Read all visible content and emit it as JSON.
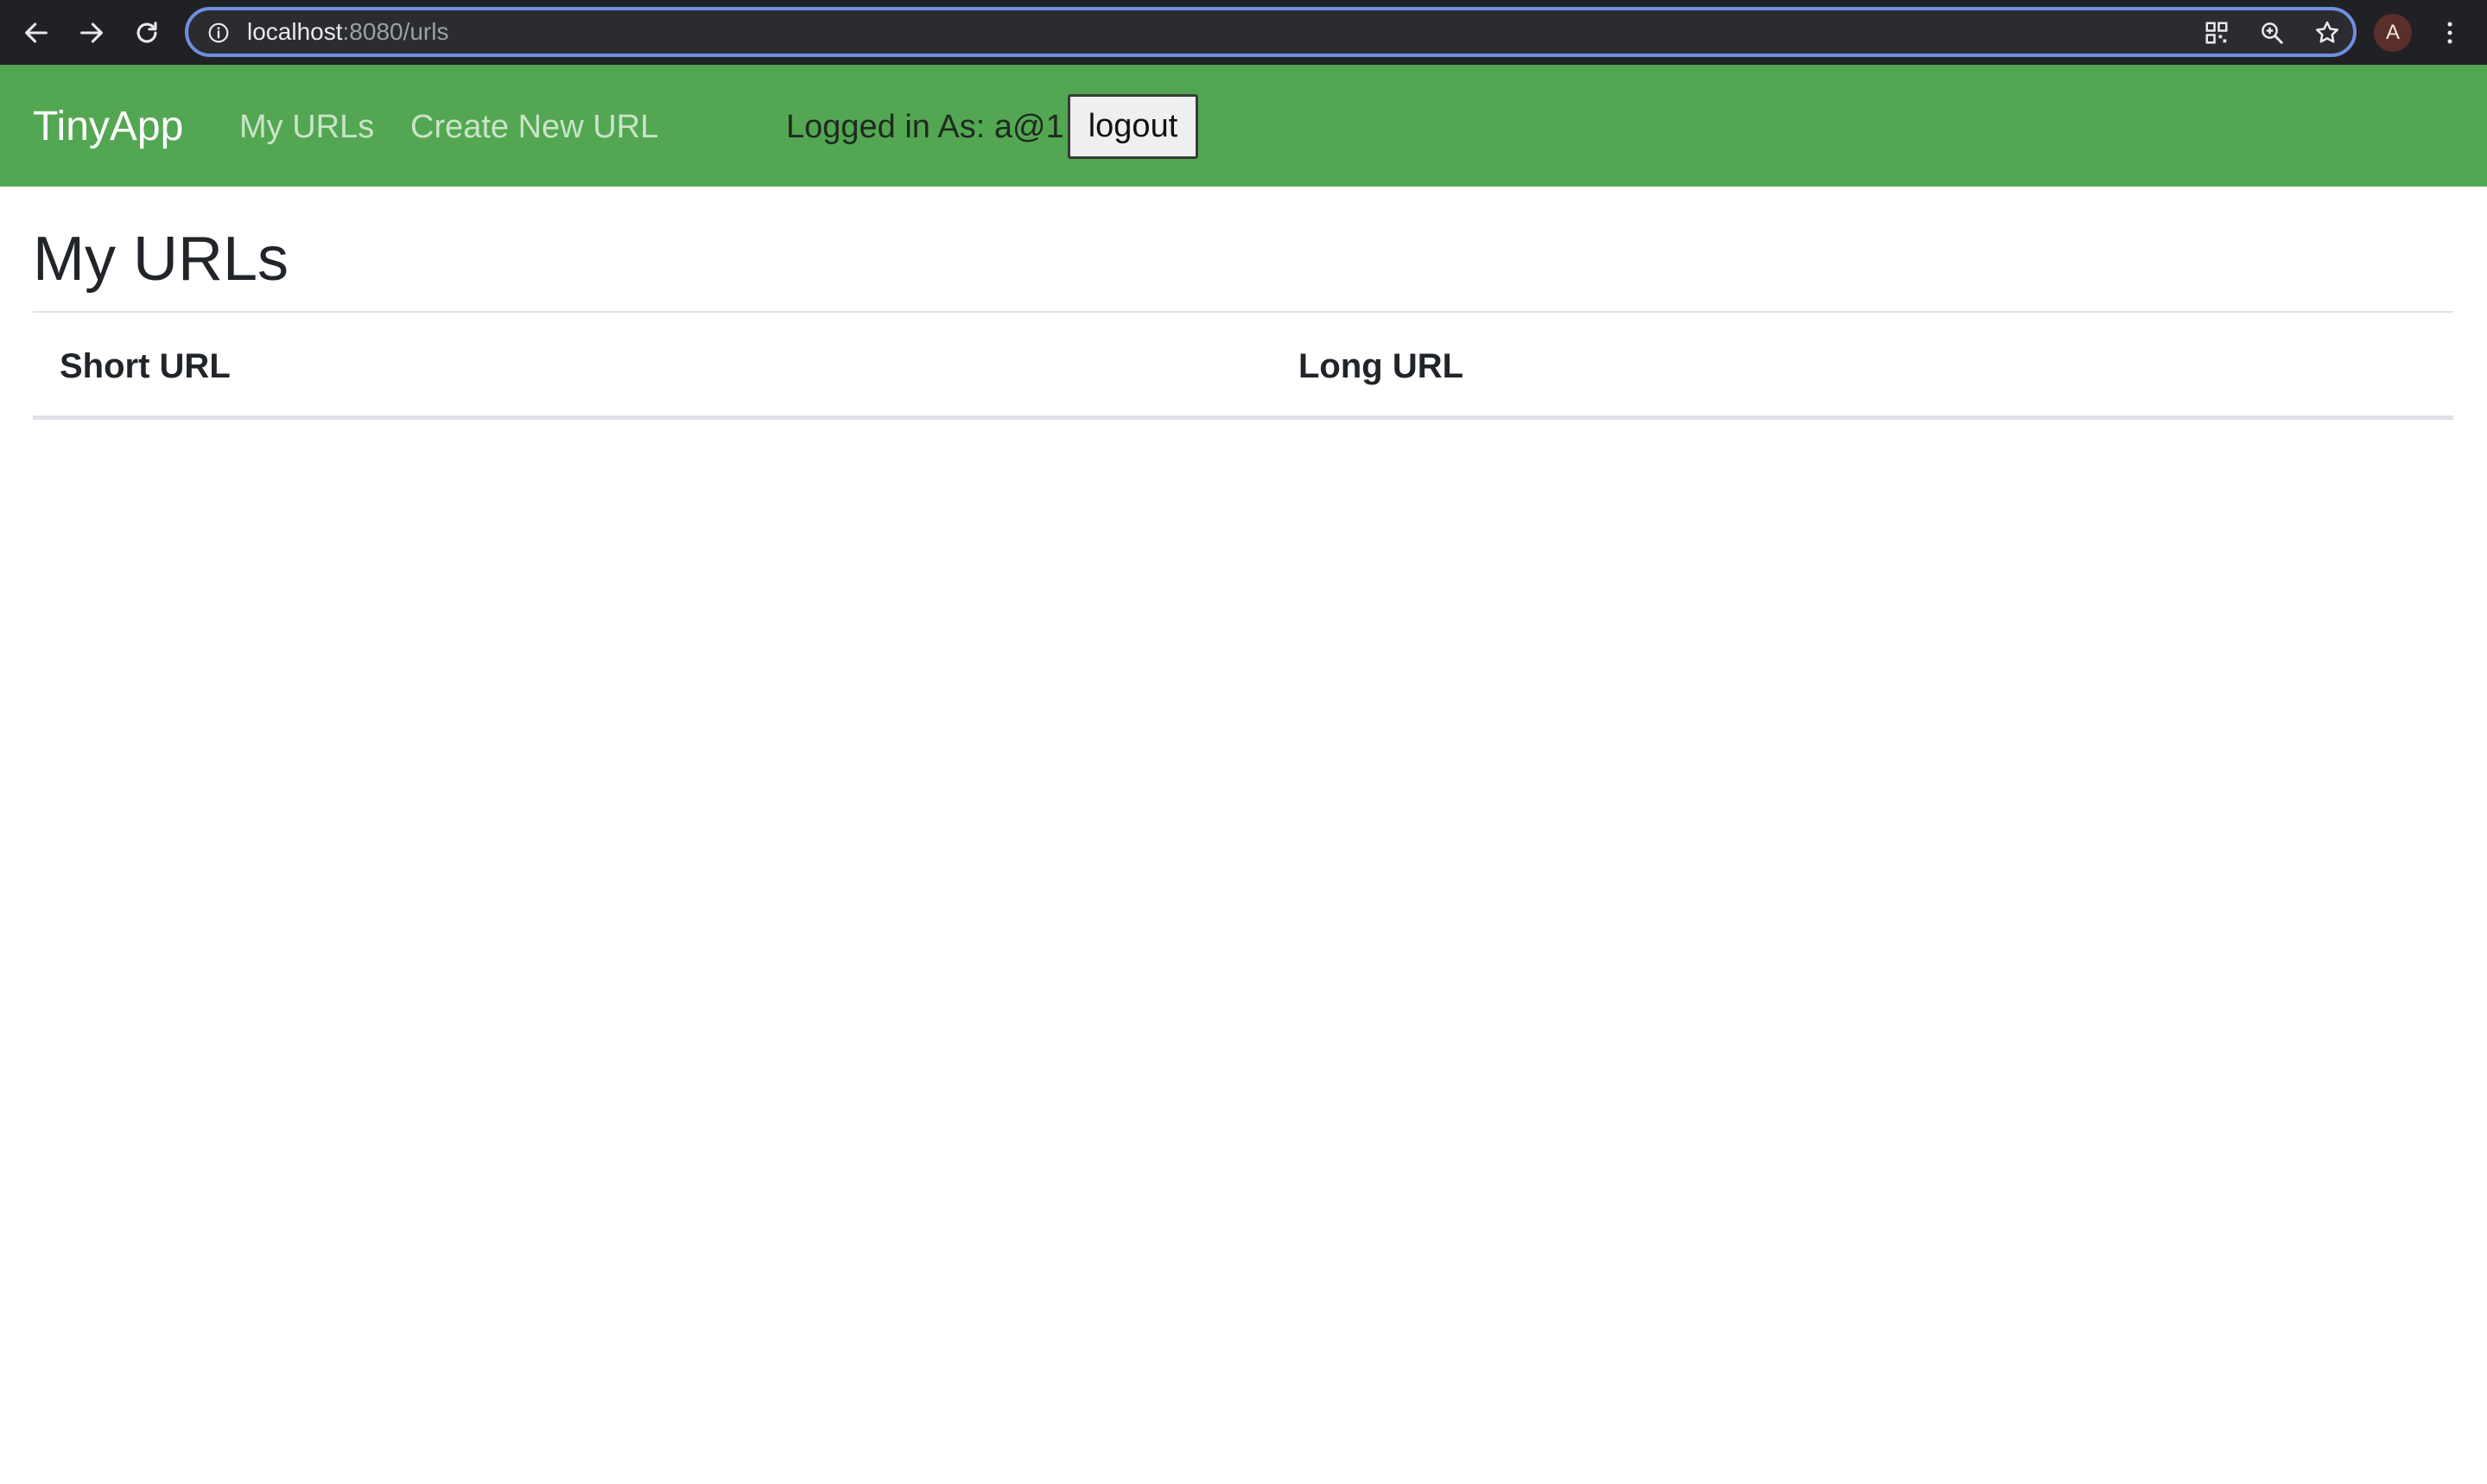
{
  "browser": {
    "url_host": "localhost",
    "url_path": ":8080/urls",
    "profile_initial": "A",
    "icons": [
      "back-arrow-icon",
      "forward-arrow-icon",
      "reload-icon",
      "site-info-icon",
      "qr-code-icon",
      "zoom-icon",
      "bookmark-star-icon",
      "menu-dots-icon"
    ]
  },
  "navbar": {
    "brand": "TinyApp",
    "links": [
      "My URLs",
      "Create New URL"
    ],
    "logged_in_text": "Logged in As: a@1",
    "logout_label": "logout",
    "background_color": "#53a752"
  },
  "main": {
    "title": "My URLs",
    "table": {
      "columns": [
        "Short URL",
        "Long URL"
      ],
      "rows": []
    }
  }
}
